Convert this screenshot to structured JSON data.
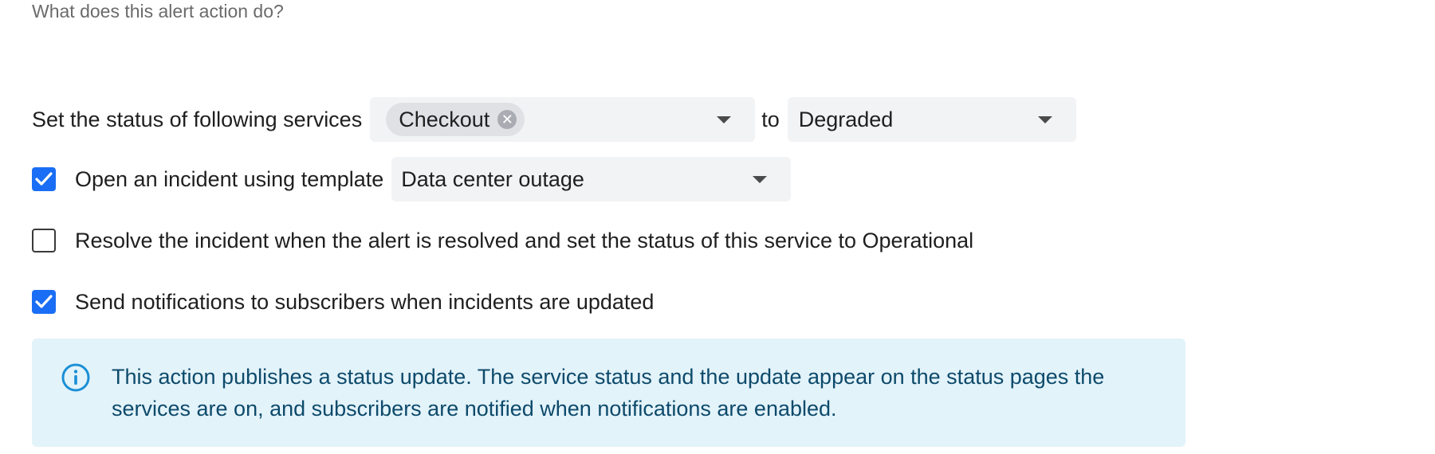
{
  "header": {
    "subtitle": "What does this alert action do?"
  },
  "status_row": {
    "label": "Set the status of following services",
    "selected_service": "Checkout",
    "to_label": "to",
    "status_value": "Degraded"
  },
  "incident_row": {
    "checked": true,
    "label": "Open an incident using template",
    "template_value": "Data center outage"
  },
  "resolve_row": {
    "checked": false,
    "label": "Resolve the incident when the alert is resolved and set the status of this service to Operational"
  },
  "notify_row": {
    "checked": true,
    "label": "Send notifications to subscribers when incidents are updated"
  },
  "info": {
    "icon": "info-icon",
    "text": "This action publishes a status update. The service status and the update appear on the status pages the services are on, and subscribers are notified when notifications are enabled."
  },
  "colors": {
    "accent": "#1a6ef5",
    "info_bg": "#e3f3fa",
    "info_text": "#0d4a6b",
    "info_icon": "#1a8fd6"
  }
}
